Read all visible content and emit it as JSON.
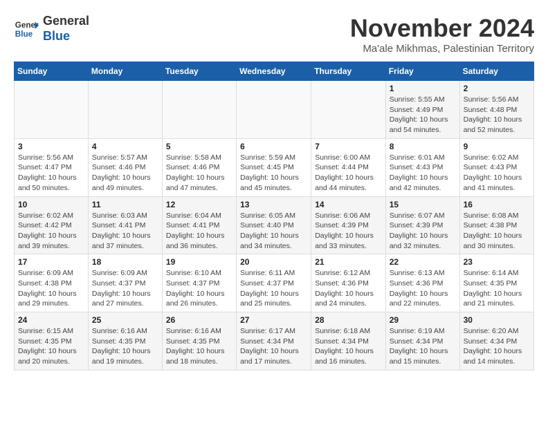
{
  "header": {
    "logo_general": "General",
    "logo_blue": "Blue",
    "month_title": "November 2024",
    "location": "Ma'ale Mikhmas, Palestinian Territory"
  },
  "weekdays": [
    "Sunday",
    "Monday",
    "Tuesday",
    "Wednesday",
    "Thursday",
    "Friday",
    "Saturday"
  ],
  "weeks": [
    [
      {
        "day": "",
        "info": ""
      },
      {
        "day": "",
        "info": ""
      },
      {
        "day": "",
        "info": ""
      },
      {
        "day": "",
        "info": ""
      },
      {
        "day": "",
        "info": ""
      },
      {
        "day": "1",
        "info": "Sunrise: 5:55 AM\nSunset: 4:49 PM\nDaylight: 10 hours and 54 minutes."
      },
      {
        "day": "2",
        "info": "Sunrise: 5:56 AM\nSunset: 4:48 PM\nDaylight: 10 hours and 52 minutes."
      }
    ],
    [
      {
        "day": "3",
        "info": "Sunrise: 5:56 AM\nSunset: 4:47 PM\nDaylight: 10 hours and 50 minutes."
      },
      {
        "day": "4",
        "info": "Sunrise: 5:57 AM\nSunset: 4:46 PM\nDaylight: 10 hours and 49 minutes."
      },
      {
        "day": "5",
        "info": "Sunrise: 5:58 AM\nSunset: 4:46 PM\nDaylight: 10 hours and 47 minutes."
      },
      {
        "day": "6",
        "info": "Sunrise: 5:59 AM\nSunset: 4:45 PM\nDaylight: 10 hours and 45 minutes."
      },
      {
        "day": "7",
        "info": "Sunrise: 6:00 AM\nSunset: 4:44 PM\nDaylight: 10 hours and 44 minutes."
      },
      {
        "day": "8",
        "info": "Sunrise: 6:01 AM\nSunset: 4:43 PM\nDaylight: 10 hours and 42 minutes."
      },
      {
        "day": "9",
        "info": "Sunrise: 6:02 AM\nSunset: 4:43 PM\nDaylight: 10 hours and 41 minutes."
      }
    ],
    [
      {
        "day": "10",
        "info": "Sunrise: 6:02 AM\nSunset: 4:42 PM\nDaylight: 10 hours and 39 minutes."
      },
      {
        "day": "11",
        "info": "Sunrise: 6:03 AM\nSunset: 4:41 PM\nDaylight: 10 hours and 37 minutes."
      },
      {
        "day": "12",
        "info": "Sunrise: 6:04 AM\nSunset: 4:41 PM\nDaylight: 10 hours and 36 minutes."
      },
      {
        "day": "13",
        "info": "Sunrise: 6:05 AM\nSunset: 4:40 PM\nDaylight: 10 hours and 34 minutes."
      },
      {
        "day": "14",
        "info": "Sunrise: 6:06 AM\nSunset: 4:39 PM\nDaylight: 10 hours and 33 minutes."
      },
      {
        "day": "15",
        "info": "Sunrise: 6:07 AM\nSunset: 4:39 PM\nDaylight: 10 hours and 32 minutes."
      },
      {
        "day": "16",
        "info": "Sunrise: 6:08 AM\nSunset: 4:38 PM\nDaylight: 10 hours and 30 minutes."
      }
    ],
    [
      {
        "day": "17",
        "info": "Sunrise: 6:09 AM\nSunset: 4:38 PM\nDaylight: 10 hours and 29 minutes."
      },
      {
        "day": "18",
        "info": "Sunrise: 6:09 AM\nSunset: 4:37 PM\nDaylight: 10 hours and 27 minutes."
      },
      {
        "day": "19",
        "info": "Sunrise: 6:10 AM\nSunset: 4:37 PM\nDaylight: 10 hours and 26 minutes."
      },
      {
        "day": "20",
        "info": "Sunrise: 6:11 AM\nSunset: 4:37 PM\nDaylight: 10 hours and 25 minutes."
      },
      {
        "day": "21",
        "info": "Sunrise: 6:12 AM\nSunset: 4:36 PM\nDaylight: 10 hours and 24 minutes."
      },
      {
        "day": "22",
        "info": "Sunrise: 6:13 AM\nSunset: 4:36 PM\nDaylight: 10 hours and 22 minutes."
      },
      {
        "day": "23",
        "info": "Sunrise: 6:14 AM\nSunset: 4:35 PM\nDaylight: 10 hours and 21 minutes."
      }
    ],
    [
      {
        "day": "24",
        "info": "Sunrise: 6:15 AM\nSunset: 4:35 PM\nDaylight: 10 hours and 20 minutes."
      },
      {
        "day": "25",
        "info": "Sunrise: 6:16 AM\nSunset: 4:35 PM\nDaylight: 10 hours and 19 minutes."
      },
      {
        "day": "26",
        "info": "Sunrise: 6:16 AM\nSunset: 4:35 PM\nDaylight: 10 hours and 18 minutes."
      },
      {
        "day": "27",
        "info": "Sunrise: 6:17 AM\nSunset: 4:34 PM\nDaylight: 10 hours and 17 minutes."
      },
      {
        "day": "28",
        "info": "Sunrise: 6:18 AM\nSunset: 4:34 PM\nDaylight: 10 hours and 16 minutes."
      },
      {
        "day": "29",
        "info": "Sunrise: 6:19 AM\nSunset: 4:34 PM\nDaylight: 10 hours and 15 minutes."
      },
      {
        "day": "30",
        "info": "Sunrise: 6:20 AM\nSunset: 4:34 PM\nDaylight: 10 hours and 14 minutes."
      }
    ]
  ]
}
